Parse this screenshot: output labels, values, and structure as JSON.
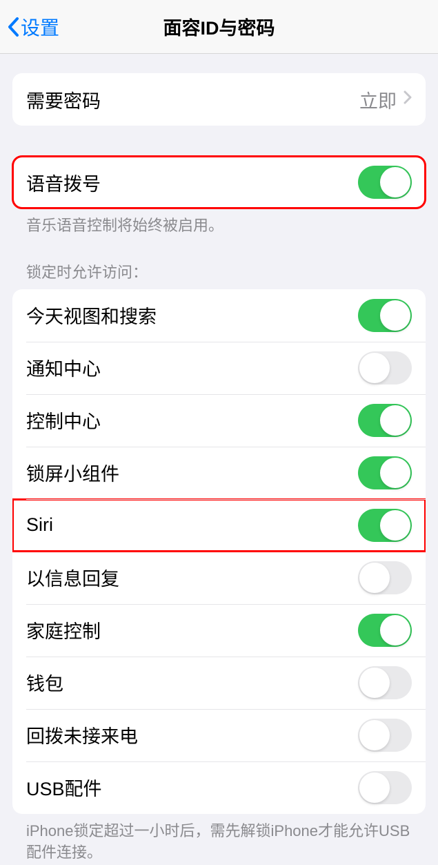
{
  "header": {
    "back_label": "设置",
    "title": "面容ID与密码"
  },
  "passcode_section": {
    "label": "需要密码",
    "value": "立即"
  },
  "voice_dial": {
    "label": "语音拨号",
    "on": true,
    "footer": "音乐语音控制将始终被启用。"
  },
  "lock_access": {
    "header": "锁定时允许访问：",
    "items": [
      {
        "label": "今天视图和搜索",
        "on": true,
        "highlighted": false
      },
      {
        "label": "通知中心",
        "on": false,
        "highlighted": false
      },
      {
        "label": "控制中心",
        "on": true,
        "highlighted": false
      },
      {
        "label": "锁屏小组件",
        "on": true,
        "highlighted": false
      },
      {
        "label": "Siri",
        "on": true,
        "highlighted": true
      },
      {
        "label": "以信息回复",
        "on": false,
        "highlighted": false
      },
      {
        "label": "家庭控制",
        "on": true,
        "highlighted": false
      },
      {
        "label": "钱包",
        "on": false,
        "highlighted": false
      },
      {
        "label": "回拨未接来电",
        "on": false,
        "highlighted": false
      },
      {
        "label": "USB配件",
        "on": false,
        "highlighted": false
      }
    ],
    "footer": "iPhone锁定超过一小时后，需先解锁iPhone才能允许USB配件连接。"
  }
}
